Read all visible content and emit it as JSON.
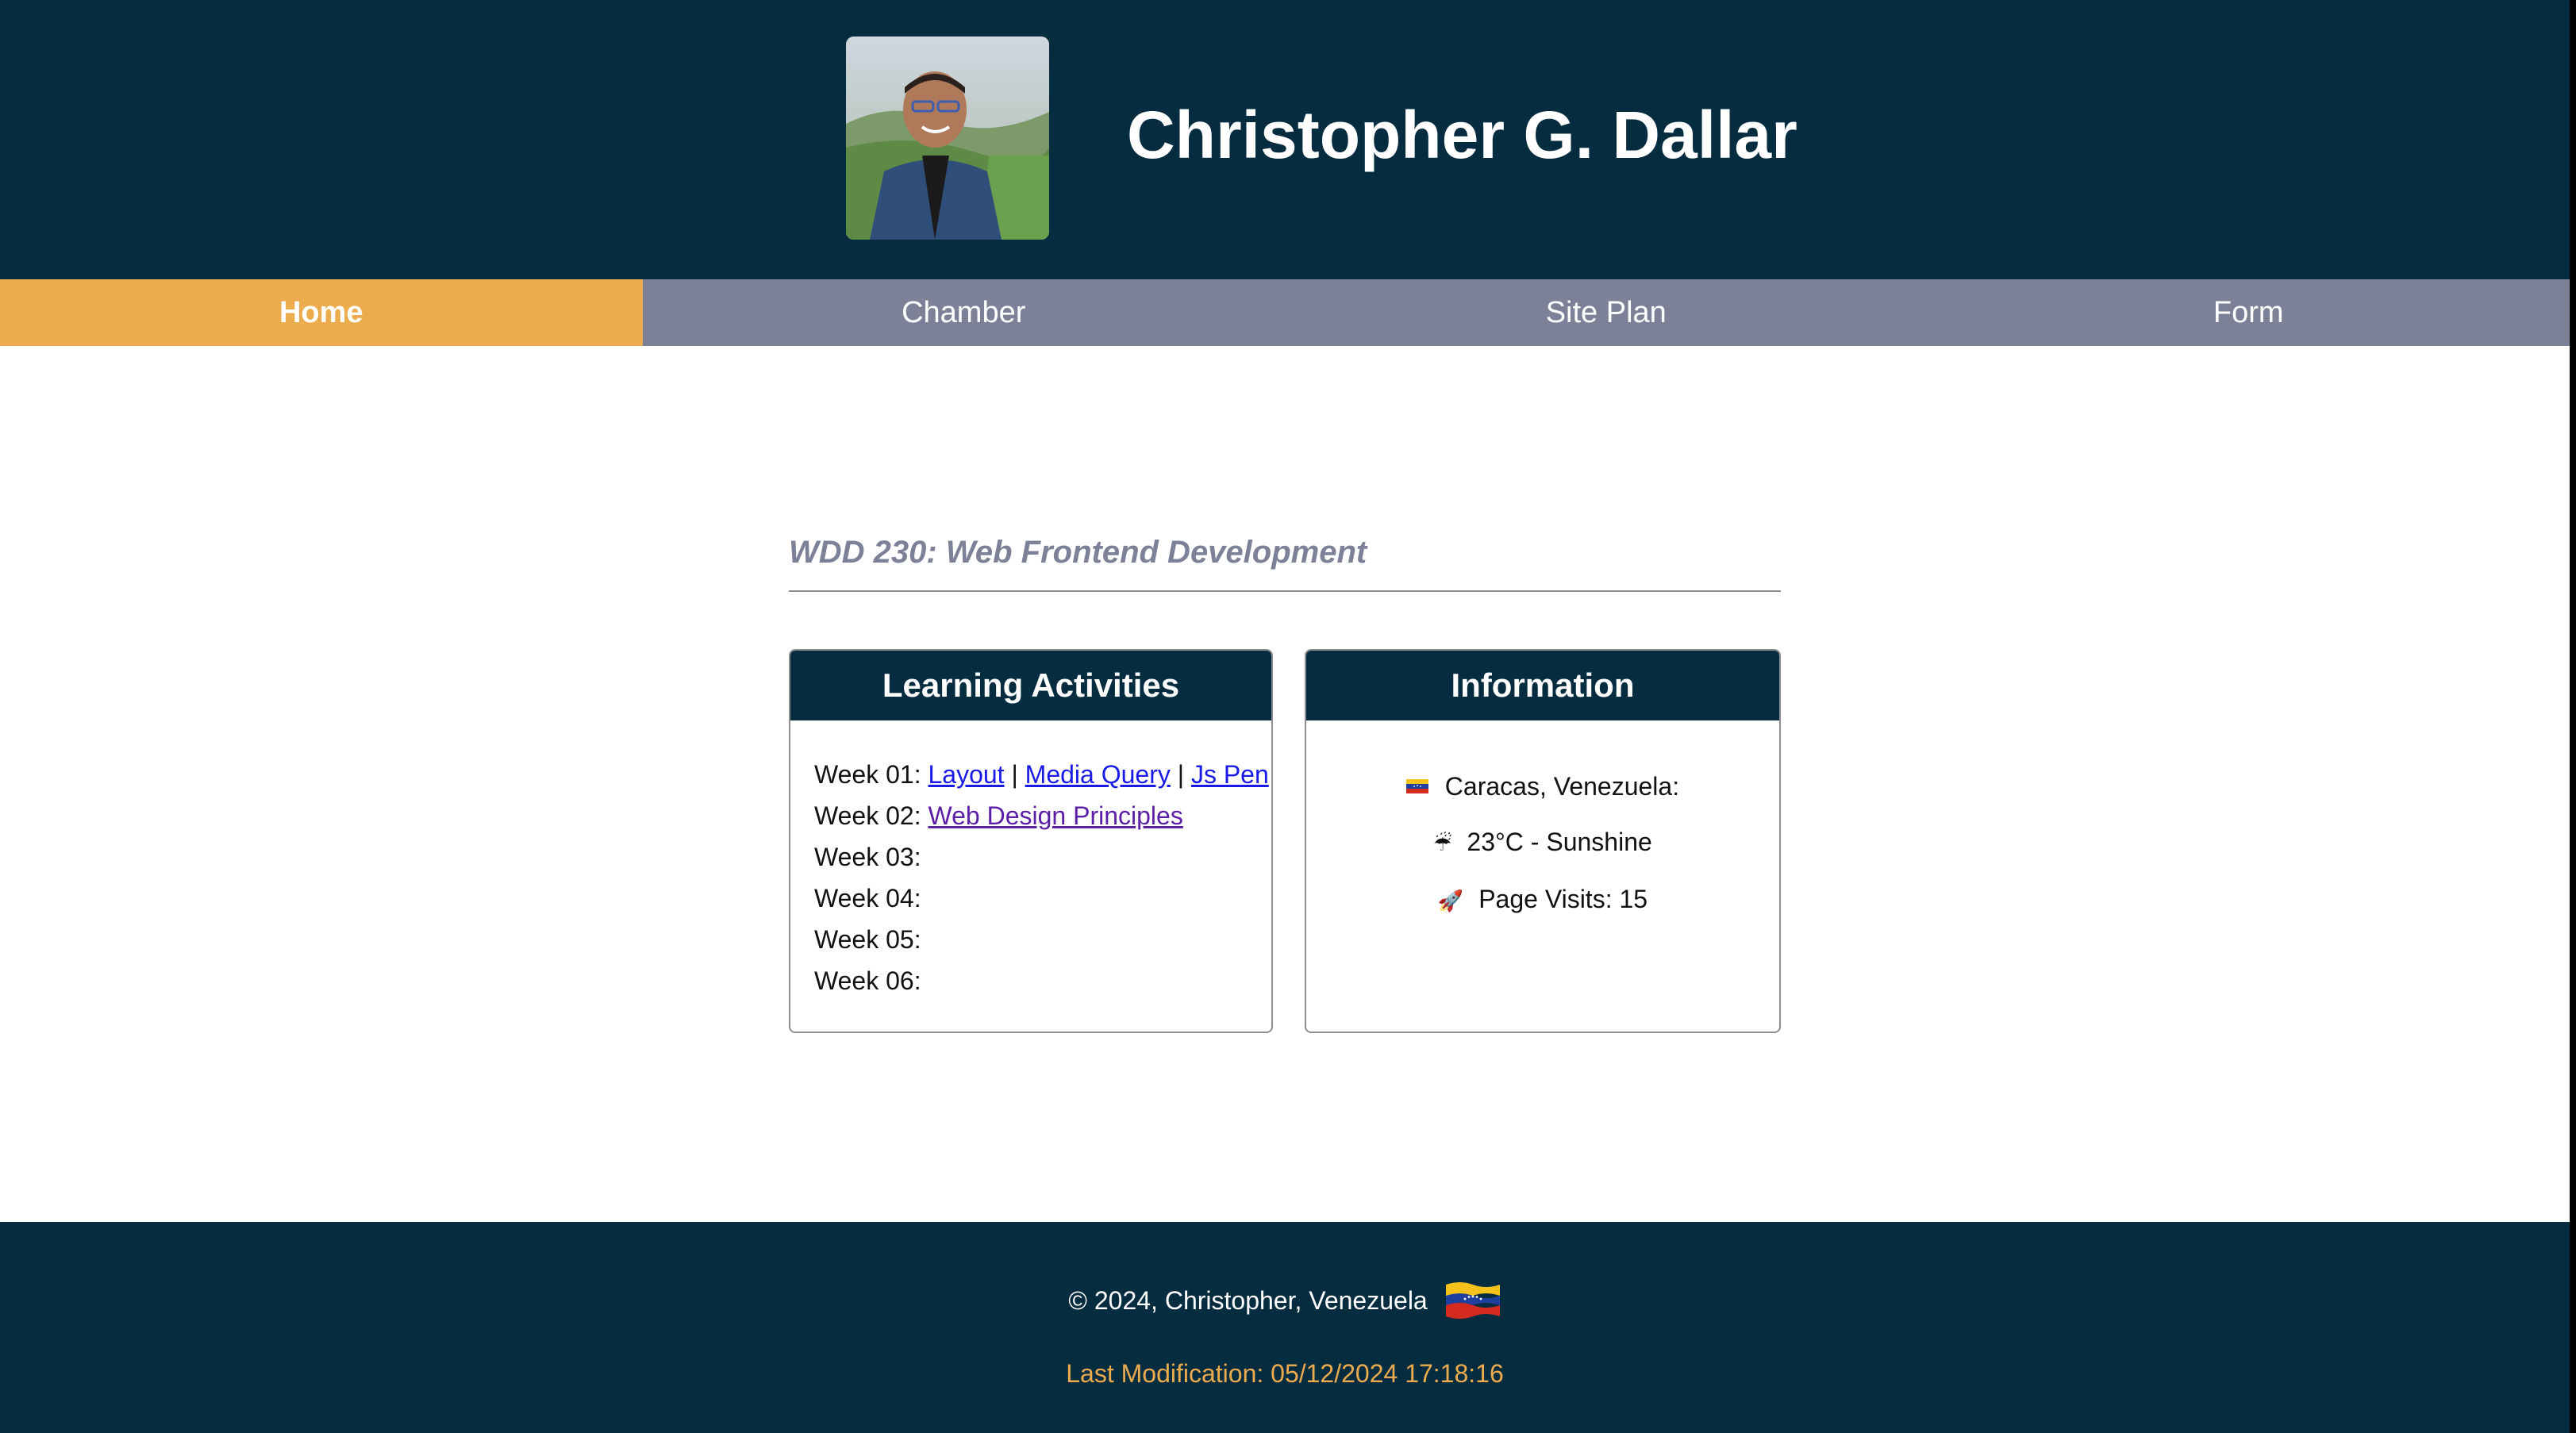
{
  "header": {
    "title": "Christopher G. Dallar",
    "avatar_icon": "profile-photo"
  },
  "nav": {
    "items": [
      {
        "label": "Home",
        "active": true
      },
      {
        "label": "Chamber",
        "active": false
      },
      {
        "label": "Site Plan",
        "active": false
      },
      {
        "label": "Form",
        "active": false
      }
    ]
  },
  "main": {
    "heading": "WDD 230: Web Frontend Development",
    "activities": {
      "title": "Learning Activities",
      "weeks": [
        {
          "label": "Week 01:",
          "links": [
            "Layout",
            "Media Query",
            "Js Pen"
          ],
          "separator": "|"
        },
        {
          "label": "Week 02:",
          "links": [
            "Web Design Principles"
          ]
        },
        {
          "label": "Week 03:"
        },
        {
          "label": "Week 04:"
        },
        {
          "label": "Week 05:"
        },
        {
          "label": "Week 06:"
        }
      ]
    },
    "information": {
      "title": "Information",
      "location": "Caracas, Venezuela:",
      "weather_icon": "☔",
      "weather": "23°C - Sunshine",
      "visits_icon": "🚀",
      "visits": "Page Visits: 15"
    }
  },
  "footer": {
    "copyright": "© 2024, Christopher, Venezuela",
    "last_modification": "Last Modification: 05/12/2024 17:18:16"
  },
  "colors": {
    "header_bg": "#062c3f",
    "nav_bg": "#7c8198",
    "nav_active": "#ecac4e",
    "link": "#1a1ae6",
    "visited_link": "#5a1fa6",
    "footer_accent": "#ecac4e"
  }
}
